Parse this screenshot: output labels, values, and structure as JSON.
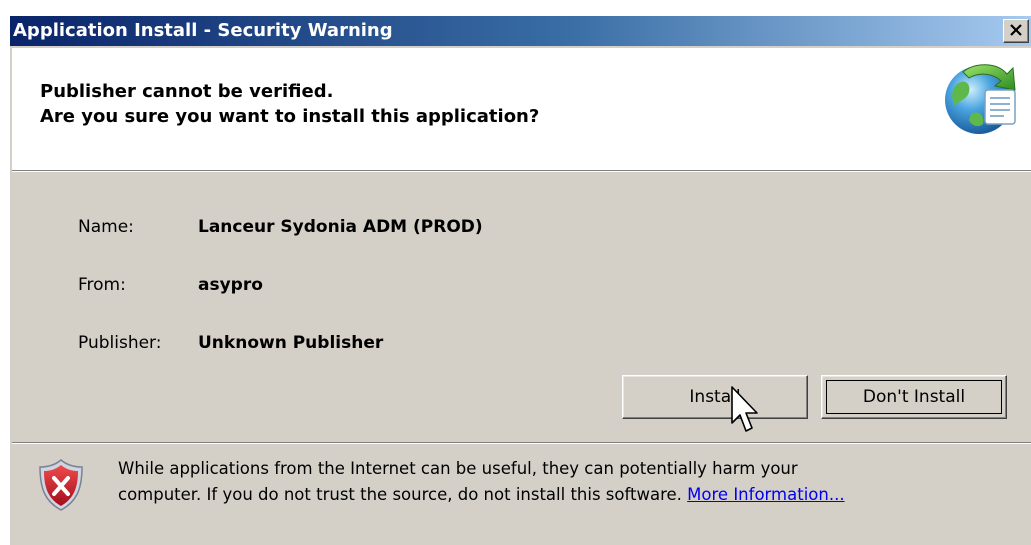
{
  "window": {
    "title": "Application Install - Security Warning",
    "close_glyph": "✕"
  },
  "header": {
    "line1": "Publisher cannot be verified.",
    "line2": "Are you sure you want to install this application?",
    "icon": "globe-install-icon"
  },
  "details": [
    {
      "label": "Name:",
      "value": "Lanceur Sydonia ADM (PROD)"
    },
    {
      "label": "From:",
      "value": "asypro"
    },
    {
      "label": "Publisher:",
      "value": "Unknown Publisher"
    }
  ],
  "buttons": {
    "install": "Install",
    "dont_install": "Don't Install"
  },
  "warning": {
    "icon": "security-shield-icon",
    "line1": "While applications from the Internet can be useful, they can potentially harm your",
    "line2": "computer. If you do not trust the source, do not install this software.",
    "link": "More Information..."
  },
  "colors": {
    "titlebar_start": "#0a246a",
    "titlebar_end": "#a6caf0",
    "dialog_bg": "#d4d0c8",
    "link": "#0000ee",
    "shield_red": "#c8102e"
  }
}
